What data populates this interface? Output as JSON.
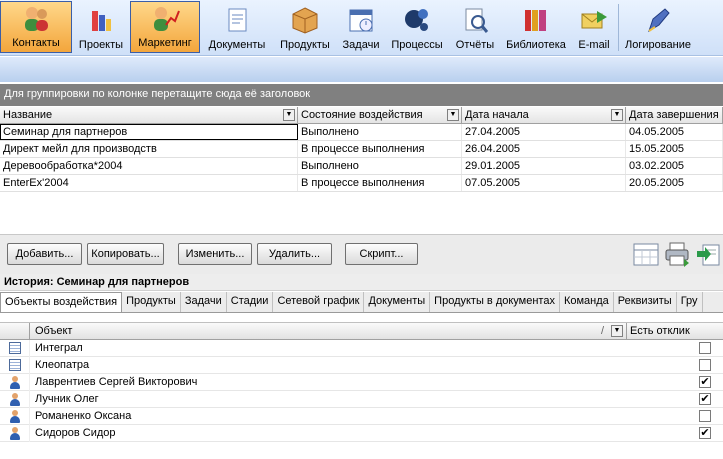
{
  "toolbar": {
    "buttons": [
      {
        "label": "Контакты",
        "icon": "contacts-icon",
        "active": true
      },
      {
        "label": "Проекты",
        "icon": "projects-icon"
      },
      {
        "label": "Маркетинг",
        "icon": "marketing-icon",
        "active": true
      },
      {
        "label": "Документы",
        "icon": "documents-icon"
      },
      {
        "label": "Продукты",
        "icon": "products-icon"
      },
      {
        "label": "Задачи",
        "icon": "tasks-icon"
      },
      {
        "label": "Процессы",
        "icon": "processes-icon"
      },
      {
        "label": "Отчёты",
        "icon": "reports-icon"
      },
      {
        "label": "Библиотека",
        "icon": "library-icon"
      },
      {
        "label": "E-mail",
        "icon": "email-icon"
      },
      {
        "label": "Логирование",
        "icon": "logging-icon"
      }
    ]
  },
  "group_panel": "Для группировки по колонке перетащите сюда её заголовок",
  "grid": {
    "columns": [
      "Название",
      "Состояние воздействия",
      "Дата начала",
      "Дата завершения"
    ],
    "rows": [
      [
        "Семинар для партнеров",
        "Выполнено",
        "27.04.2005",
        "04.05.2005"
      ],
      [
        "Директ мейл для производств",
        "В процессе выполнения",
        "26.04.2005",
        "15.05.2005"
      ],
      [
        "Деревообработка*2004",
        "Выполнено",
        "29.01.2005",
        "03.02.2005"
      ],
      [
        "EnterEx'2004",
        "В процессе выполнения",
        "07.05.2005",
        "20.05.2005"
      ]
    ]
  },
  "actions": {
    "add": "Добавить...",
    "copy": "Копировать...",
    "edit": "Изменить...",
    "delete": "Удалить...",
    "script": "Скрипт..."
  },
  "history_title": "История: Семинар для партнеров",
  "tabs": [
    "Объекты воздействия",
    "Продукты",
    "Задачи",
    "Стадии",
    "Сетевой график",
    "Документы",
    "Продукты в документах",
    "Команда",
    "Реквизиты",
    "Гру"
  ],
  "objects": {
    "columns": [
      "Объект",
      "Есть отклик"
    ],
    "sort_marker": "/",
    "rows": [
      {
        "name": "Интеграл",
        "type": "company",
        "response": false
      },
      {
        "name": "Клеопатра",
        "type": "company",
        "response": false
      },
      {
        "name": "Лаврентиев Сергей Викторович",
        "type": "person",
        "response": true
      },
      {
        "name": "Лучник Олег",
        "type": "person",
        "response": true
      },
      {
        "name": "Романенко Оксана",
        "type": "person",
        "response": false
      },
      {
        "name": "Сидоров Сидор",
        "type": "person",
        "response": true
      }
    ]
  },
  "colors": {
    "active_button": "#f3a63c",
    "group_panel": "#808080",
    "toolbar": "#cfe0f8"
  }
}
